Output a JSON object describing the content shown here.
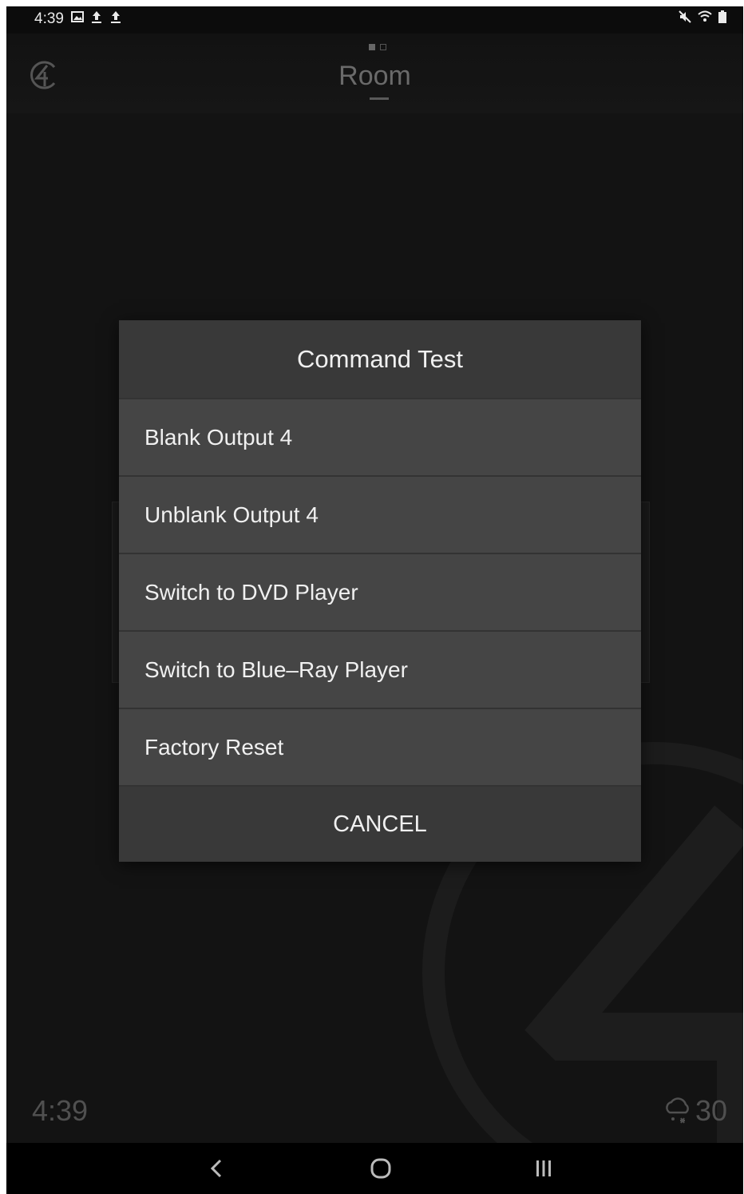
{
  "status_bar": {
    "time": "4:39",
    "left_icons": [
      "image-icon",
      "upload-icon",
      "upload-icon"
    ],
    "right_icons": [
      "mute-icon",
      "wifi-icon",
      "battery-icon"
    ]
  },
  "header": {
    "title": "Room",
    "logo_icon": "control4-logo-icon",
    "page_count": 2,
    "active_page": 1
  },
  "dialog": {
    "title": "Command Test",
    "items": [
      {
        "label": "Blank Output 4"
      },
      {
        "label": "Unblank Output 4"
      },
      {
        "label": "Switch to DVD Player"
      },
      {
        "label": "Switch to Blue–Ray Player"
      },
      {
        "label": "Factory Reset"
      }
    ],
    "cancel_label": "CANCEL"
  },
  "footer": {
    "clock": "4:39",
    "weather_icon": "cloud-snow-icon",
    "temperature": "30"
  },
  "nav_bar": {
    "back_icon": "back-icon",
    "home_icon": "home-icon",
    "recents_icon": "recents-icon"
  },
  "colors": {
    "background": "#131313",
    "dialog_header": "#393939",
    "dialog_item": "#454545",
    "text": "#f0f0f0",
    "muted_text": "#505050"
  }
}
